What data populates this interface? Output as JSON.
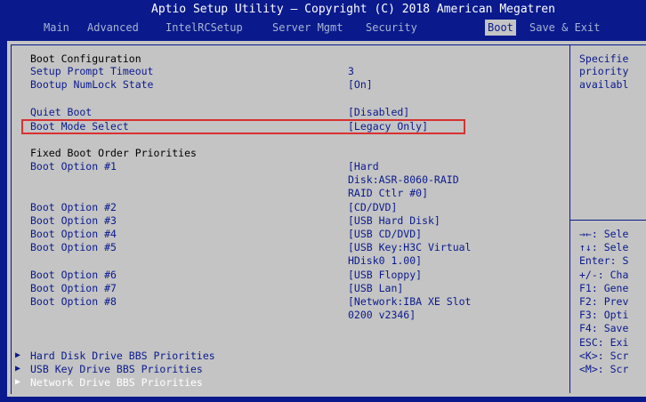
{
  "title": "Aptio Setup Utility – Copyright (C) 2018 American Megatren",
  "menu": [
    "Main",
    "Advanced",
    "IntelRCSetup",
    "Server Mgmt",
    "Security",
    "Boot",
    "Save & Exit"
  ],
  "active_menu": "Boot",
  "settings": {
    "boot_configuration": "Boot Configuration",
    "setup_prompt_timeout": {
      "label": "Setup Prompt Timeout",
      "value": "3"
    },
    "bootup_numlock_state": {
      "label": "Bootup NumLock State",
      "value": "[On]"
    },
    "quiet_boot": {
      "label": "Quiet Boot",
      "value": "[Disabled]"
    },
    "boot_mode_select": {
      "label": "Boot Mode Select",
      "value": "[Legacy Only]"
    },
    "fixed_boot_order": "Fixed Boot Order Priorities",
    "boot_options": [
      {
        "label": "Boot Option #1",
        "value": [
          "[Hard",
          "Disk:ASR-8060-RAID",
          "RAID Ctlr #0]"
        ]
      },
      {
        "label": "Boot Option #2",
        "value": [
          "[CD/DVD]"
        ]
      },
      {
        "label": "Boot Option #3",
        "value": [
          "[USB Hard Disk]"
        ]
      },
      {
        "label": "Boot Option #4",
        "value": [
          "[USB CD/DVD]"
        ]
      },
      {
        "label": "Boot Option #5",
        "value": [
          "[USB Key:H3C Virtual",
          "HDisk0 1.00]"
        ]
      },
      {
        "label": "Boot Option #6",
        "value": [
          "[USB Floppy]"
        ]
      },
      {
        "label": "Boot Option #7",
        "value": [
          "[USB Lan]"
        ]
      },
      {
        "label": "Boot Option #8",
        "value": [
          "[Network:IBA XE Slot",
          "0200 v2346]"
        ]
      }
    ],
    "submenus": [
      "Hard Disk Drive BBS Priorities",
      "USB Key Drive BBS Priorities",
      "Network Drive BBS Priorities"
    ]
  },
  "help": {
    "description": [
      "Specifie",
      "priority",
      "availabl"
    ],
    "keys": [
      "→←: Sele",
      "↑↓: Sele",
      "Enter: S",
      "+/-: Cha",
      "F1: Gene",
      "F2: Prev",
      "F3: Opti",
      "F4: Save",
      "ESC: Exi",
      "<K>: Scr",
      "<M>: Scr"
    ]
  },
  "colors": {
    "header_bg": "#0a1a8c",
    "panel_bg": "#c4c4c4",
    "text_blue": "#0a1a8c",
    "highlight_box": "#d93030"
  }
}
